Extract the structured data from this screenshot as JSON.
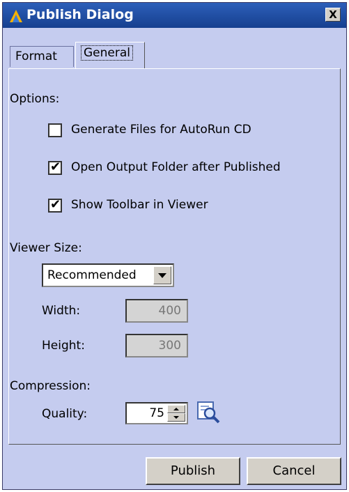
{
  "window": {
    "title": "Publish Dialog",
    "close_label": "X"
  },
  "tabs": [
    {
      "label": "Format"
    },
    {
      "label": "General",
      "selected": true
    }
  ],
  "options": {
    "heading": "Options:",
    "items": [
      {
        "label": "Generate Files for AutoRun CD",
        "checked": false
      },
      {
        "label": "Open Output Folder after Published",
        "checked": true
      },
      {
        "label": "Show Toolbar in Viewer",
        "checked": true
      }
    ]
  },
  "viewer_size": {
    "heading": "Viewer Size:",
    "preset": "Recommended",
    "width_label": "Width:",
    "width_value": "400",
    "height_label": "Height:",
    "height_value": "300"
  },
  "compression": {
    "heading": "Compression:",
    "quality_label": "Quality:",
    "quality_value": "75"
  },
  "buttons": {
    "publish": "Publish",
    "cancel": "Cancel"
  },
  "colors": {
    "title_bar": "#1f4ea6",
    "panel_bg": "#c5ccef",
    "button_face": "#d4d0c8"
  },
  "icons": {
    "app": "app-icon",
    "close": "close-icon",
    "preview": "preview-magnifier-icon"
  }
}
